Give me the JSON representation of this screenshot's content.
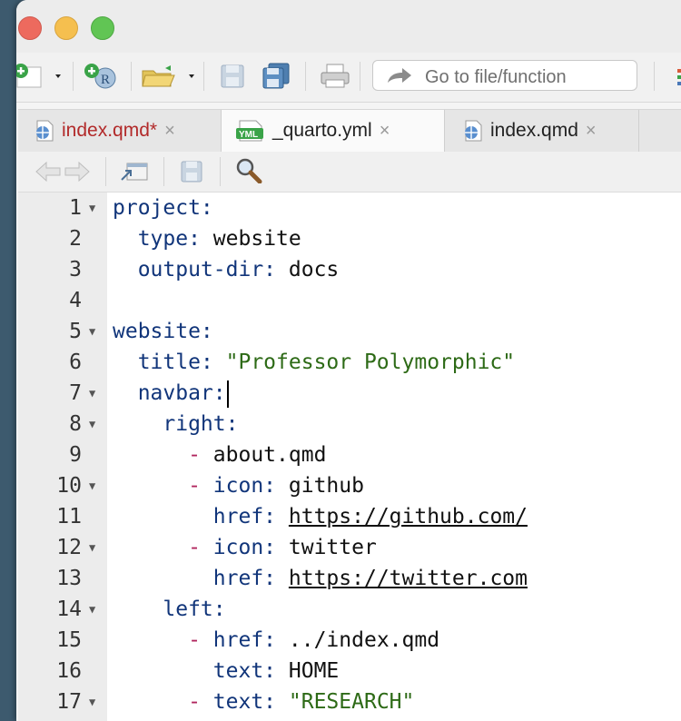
{
  "toolbar": {
    "goto_placeholder": "Go to file/function"
  },
  "tabs": [
    {
      "label": "index.qmd*",
      "modified": true,
      "active": false
    },
    {
      "label": "_quarto.yml",
      "modified": false,
      "active": true
    },
    {
      "label": "index.qmd",
      "modified": false,
      "active": false
    }
  ],
  "tab_close": "×",
  "yml_badge": "YML",
  "editor": {
    "lines": [
      {
        "n": "1",
        "fold": true,
        "indent": "",
        "dash": "",
        "key": "project:",
        "value": "",
        "vtype": ""
      },
      {
        "n": "2",
        "fold": false,
        "indent": "  ",
        "dash": "",
        "key": "type:",
        "value": " website",
        "vtype": "plain"
      },
      {
        "n": "3",
        "fold": false,
        "indent": "  ",
        "dash": "",
        "key": "output-dir:",
        "value": " docs",
        "vtype": "plain"
      },
      {
        "n": "4",
        "fold": false,
        "indent": "",
        "dash": "",
        "key": "",
        "value": "",
        "vtype": ""
      },
      {
        "n": "5",
        "fold": true,
        "indent": "",
        "dash": "",
        "key": "website:",
        "value": "",
        "vtype": ""
      },
      {
        "n": "6",
        "fold": false,
        "indent": "  ",
        "dash": "",
        "key": "title:",
        "value": " \"Professor Polymorphic\"",
        "vtype": "string"
      },
      {
        "n": "7",
        "fold": true,
        "indent": "  ",
        "dash": "",
        "key": "navbar:",
        "value": "",
        "vtype": "cursor"
      },
      {
        "n": "8",
        "fold": true,
        "indent": "    ",
        "dash": "",
        "key": "right:",
        "value": "",
        "vtype": ""
      },
      {
        "n": "9",
        "fold": false,
        "indent": "      ",
        "dash": "- ",
        "key": "",
        "value": "about.qmd",
        "vtype": "plain"
      },
      {
        "n": "10",
        "fold": true,
        "indent": "      ",
        "dash": "- ",
        "key": "icon:",
        "value": " github",
        "vtype": "plain"
      },
      {
        "n": "11",
        "fold": false,
        "indent": "        ",
        "dash": "",
        "key": "href:",
        "value": "https://github.com/",
        "vtype": "url"
      },
      {
        "n": "12",
        "fold": true,
        "indent": "      ",
        "dash": "- ",
        "key": "icon:",
        "value": " twitter",
        "vtype": "plain"
      },
      {
        "n": "13",
        "fold": false,
        "indent": "        ",
        "dash": "",
        "key": "href:",
        "value": "https://twitter.com",
        "vtype": "url"
      },
      {
        "n": "14",
        "fold": true,
        "indent": "    ",
        "dash": "",
        "key": "left:",
        "value": "",
        "vtype": ""
      },
      {
        "n": "15",
        "fold": false,
        "indent": "      ",
        "dash": "- ",
        "key": "href:",
        "value": " ../index.qmd",
        "vtype": "plain"
      },
      {
        "n": "16",
        "fold": false,
        "indent": "        ",
        "dash": "",
        "key": "text:",
        "value": " HOME",
        "vtype": "plain"
      },
      {
        "n": "17",
        "fold": true,
        "indent": "      ",
        "dash": "- ",
        "key": "text:",
        "value": " \"RESEARCH\"",
        "vtype": "string"
      }
    ]
  }
}
